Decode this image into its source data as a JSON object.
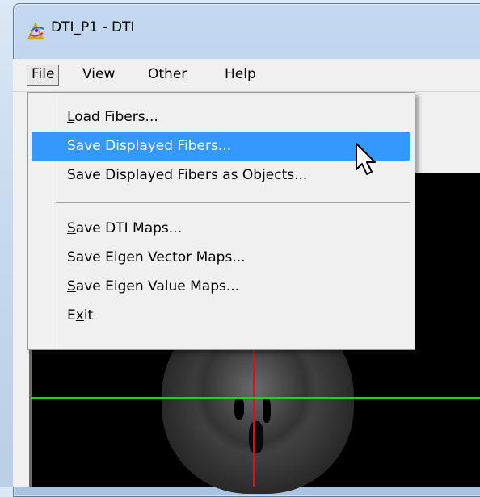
{
  "window": {
    "title": "DTI_P1 - DTI",
    "icon": "dti-app-icon"
  },
  "menubar": {
    "items": [
      {
        "label": "File",
        "active": true
      },
      {
        "label": "View",
        "active": false
      },
      {
        "label": "Other",
        "active": false
      },
      {
        "label": "Help",
        "active": false
      }
    ]
  },
  "file_menu": {
    "items": [
      {
        "label": "Load Fibers...",
        "mnemonic_index": 0
      },
      {
        "label": "Save Displayed Fibers...",
        "highlighted": true
      },
      {
        "label": "Save Displayed Fibers as Objects..."
      },
      {
        "label": "Save DTI Maps...",
        "mnemonic_index": 0
      },
      {
        "label": "Save Eigen Vector Maps..."
      },
      {
        "label": "Save Eigen Value Maps...",
        "mnemonic_index": 0
      },
      {
        "label": "Exit",
        "mnemonic_index": 1
      }
    ],
    "highlight_color": "#3399ff"
  },
  "viewport": {
    "crosshair_vertical_color": "#e01010",
    "crosshair_horizontal_color": "#19d619",
    "background": "#000000"
  }
}
